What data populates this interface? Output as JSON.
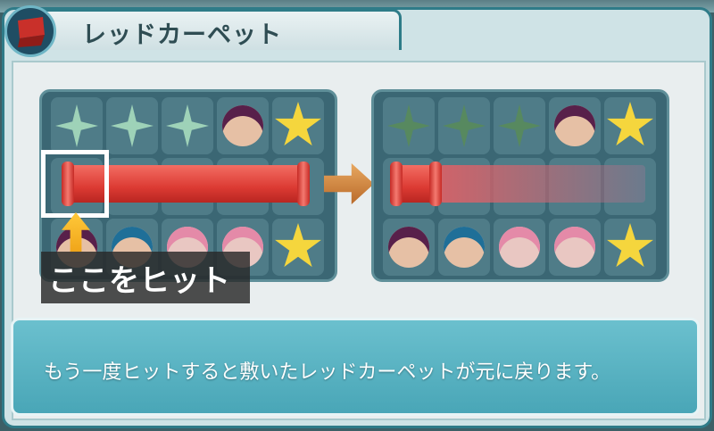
{
  "dialog": {
    "title": "レッドカーペット",
    "hint_label": "ここをヒット",
    "message": "もう一度ヒットすると敷いたレッドカーペットが元に戻ります。"
  },
  "colors": {
    "frame": "#2e7c88",
    "carpet": "#dc3a33",
    "message_bg": "#49a6b7",
    "hint_arrow": "#f0a51a"
  },
  "boards": {
    "before": {
      "row1": [
        "sparkle",
        "sparkle",
        "sparkle",
        "purple-hair-face",
        "yellow-star"
      ],
      "row3": [
        "purple-hair-face",
        "blue-hair-face",
        "pink-hair-face",
        "pink-hair-face",
        "yellow-star"
      ]
    },
    "after": {
      "row1": [
        "sparkle",
        "sparkle",
        "sparkle",
        "purple-hair-face",
        "yellow-star"
      ],
      "row3": [
        "purple-hair-face",
        "blue-hair-face",
        "pink-hair-face",
        "pink-hair-face",
        "yellow-star"
      ]
    }
  },
  "icons": {
    "title_icon": "red-carpet-icon",
    "transition_arrow": "right-arrow-icon",
    "hint_arrow": "up-arrow-icon"
  }
}
